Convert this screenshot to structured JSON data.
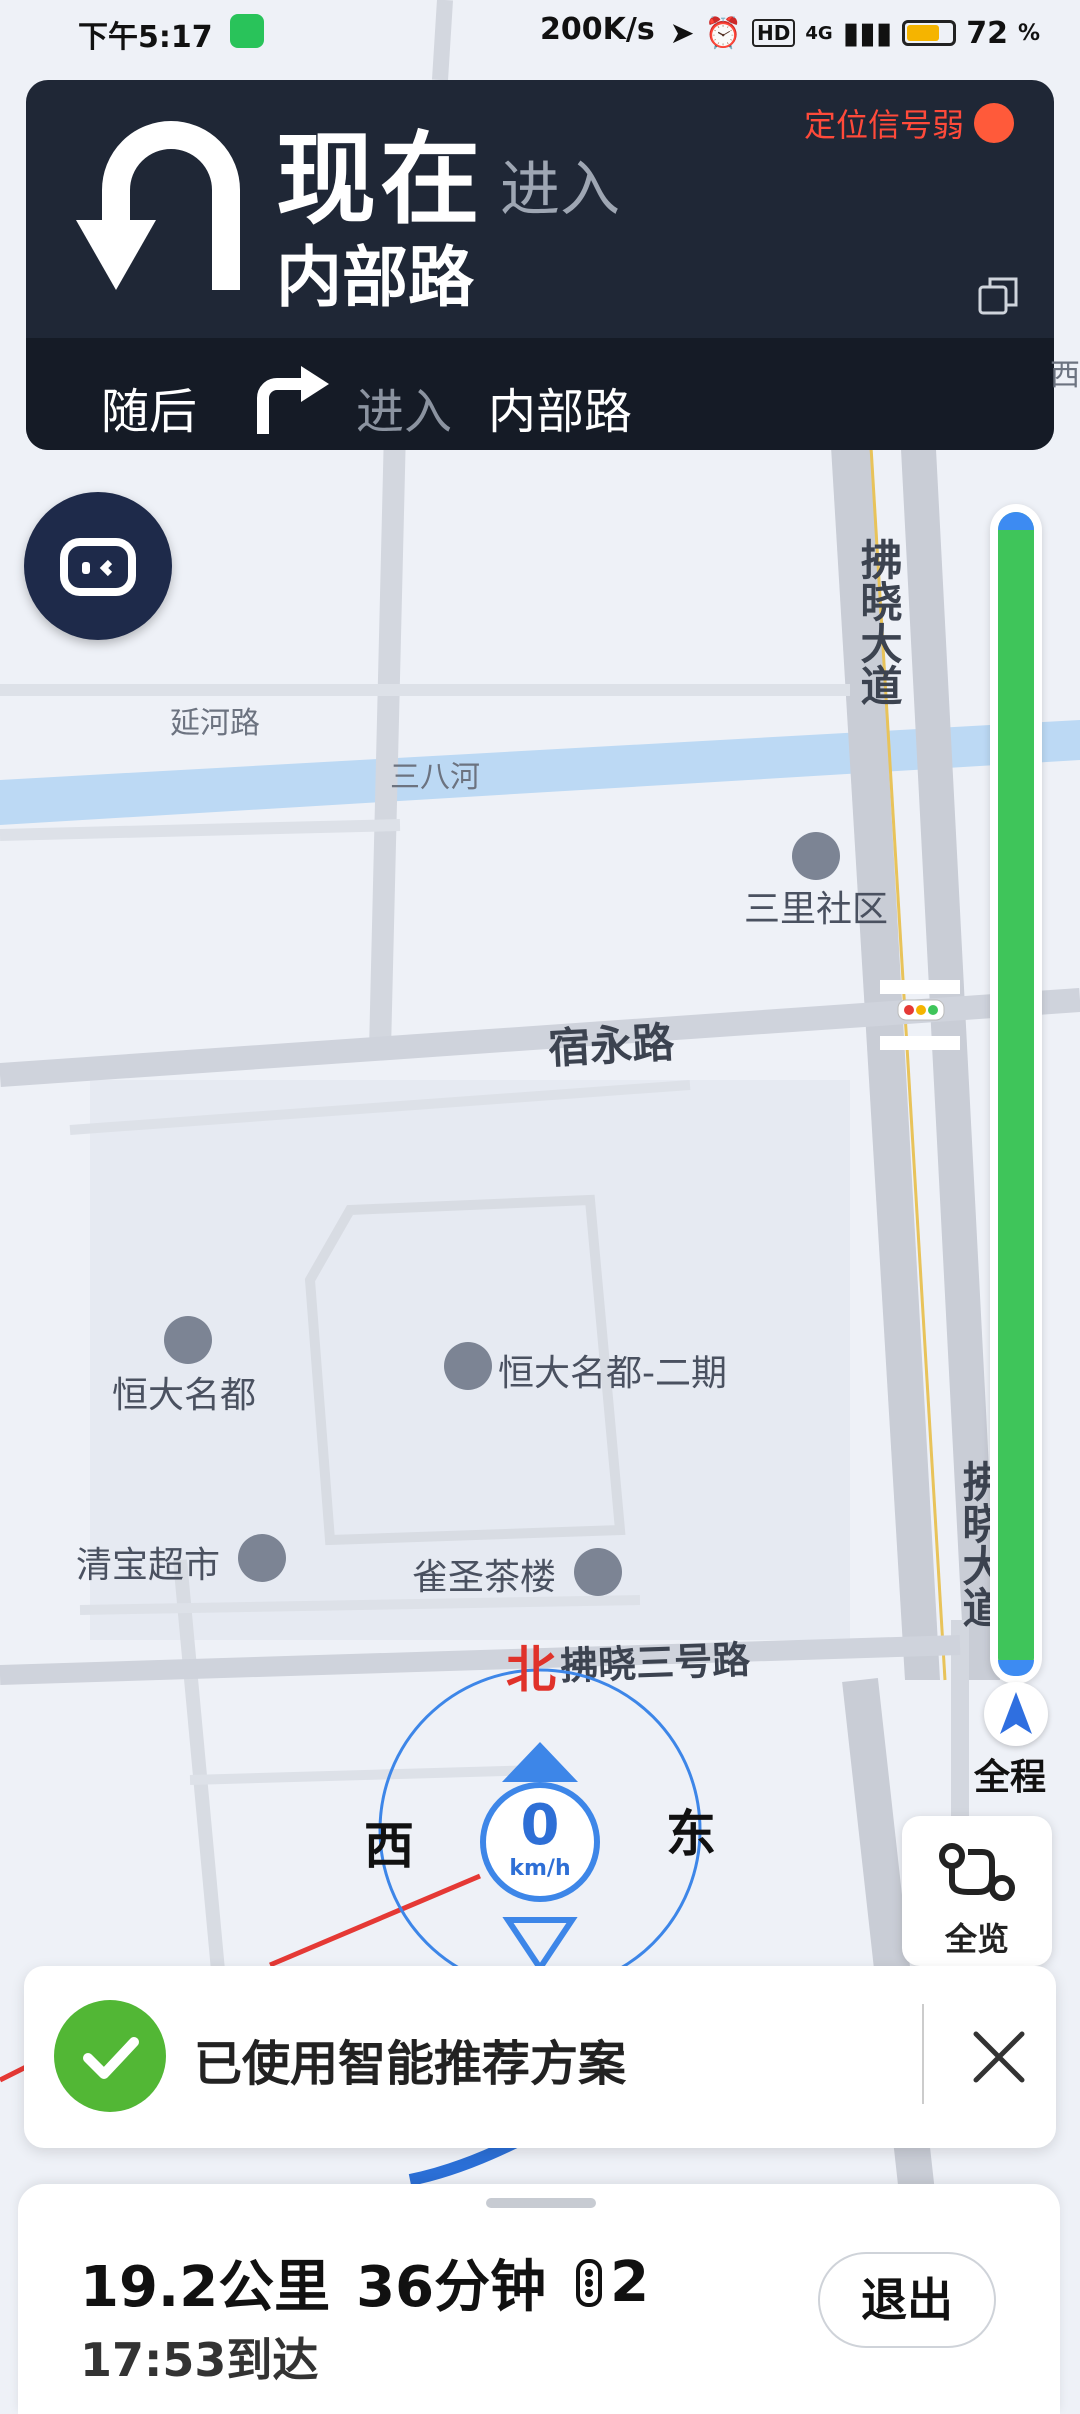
{
  "status_bar": {
    "time": "下午5:17",
    "net_speed": "200K/s",
    "hd": "HD",
    "network": "4G",
    "battery": "72",
    "battery_unit": "%"
  },
  "guidance": {
    "now": "现在",
    "enter": "进入",
    "road": "内部路",
    "signal_warning": "定位信号弱",
    "next_label": "随后",
    "next_enter": "进入",
    "next_road": "内部路"
  },
  "map": {
    "labels": {
      "yanhe_road": "延河路",
      "sanba_river": "三八河",
      "fuxiao_avenue": "拂晓大道",
      "fuxiao_avenue_2": "拂晓大道",
      "sanli_community": "三里社区",
      "suyong_road": "宿永路",
      "hengda_mingdu": "恒大名都",
      "hengda_mingdu_2": "恒大名都-二期",
      "qingbao_market": "清宝超市",
      "quesheng_teahouse": "雀圣茶楼",
      "fuxiao_3_road": "拂晓三号路",
      "edge_xi": "西"
    }
  },
  "progress": {
    "full_route_label": "全程",
    "fraction_remaining": 1.0
  },
  "overview": {
    "label": "全览"
  },
  "compass": {
    "north": "北",
    "west": "西",
    "east": "东",
    "speed": "0",
    "speed_unit": "km/h"
  },
  "toast": {
    "message": "已使用智能推荐方案"
  },
  "trip": {
    "distance": "19.2公里",
    "duration": "36分钟",
    "traffic_lights": "2",
    "arrival": "17:53到达",
    "exit_label": "退出"
  },
  "colors": {
    "route_green": "#3fc55a",
    "panel_dark": "#1f2736",
    "warning_red": "#ff4a3a",
    "accent_blue": "#3d86e8",
    "check_green": "#52b735"
  }
}
